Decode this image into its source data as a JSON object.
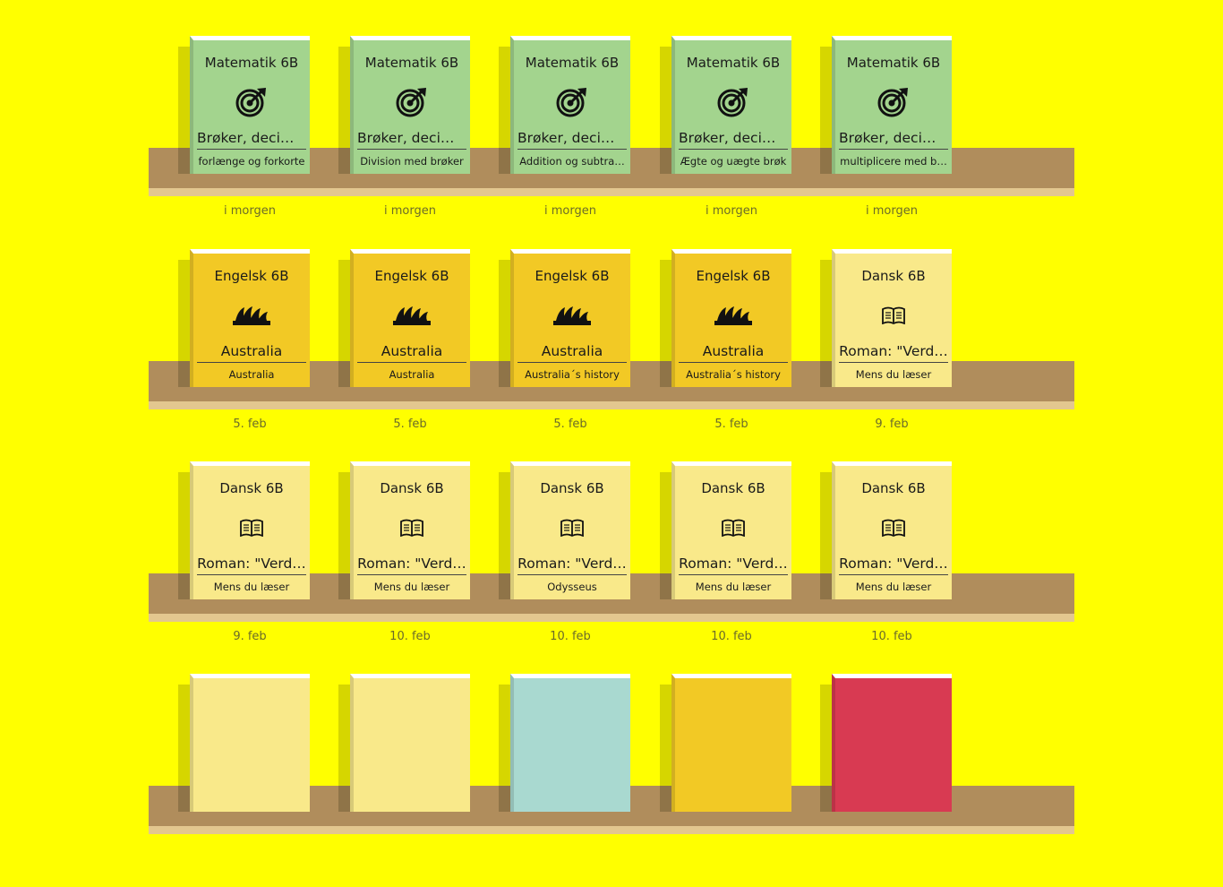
{
  "colors": {
    "background": "#ffff00",
    "matematik": "#a3d48e",
    "engelsk": "#f2c925",
    "dansk": "#f9e98a",
    "teal": "#a9d9d0",
    "red": "#d83a52"
  },
  "rows": [
    {
      "books": [
        {
          "subject": "Matematik 6B",
          "icon": "math-target-icon",
          "topic": "Brøker, decim…",
          "lesson": "forlænge og forkorte",
          "date": "i morgen",
          "theme": "matematik"
        },
        {
          "subject": "Matematik 6B",
          "icon": "math-target-icon",
          "topic": "Brøker, decim…",
          "lesson": "Division med brøker",
          "date": "i morgen",
          "theme": "matematik"
        },
        {
          "subject": "Matematik 6B",
          "icon": "math-target-icon",
          "topic": "Brøker, decim…",
          "lesson": "Addition og subtra…",
          "date": "i morgen",
          "theme": "matematik"
        },
        {
          "subject": "Matematik 6B",
          "icon": "math-target-icon",
          "topic": "Brøker, decim…",
          "lesson": "Ægte og uægte brøk",
          "date": "i morgen",
          "theme": "matematik"
        },
        {
          "subject": "Matematik 6B",
          "icon": "math-target-icon",
          "topic": "Brøker, decim…",
          "lesson": "multiplicere med b…",
          "date": "i morgen",
          "theme": "matematik"
        }
      ]
    },
    {
      "books": [
        {
          "subject": "Engelsk 6B",
          "icon": "opera-house-icon",
          "topic": "Australia",
          "lesson": "Australia",
          "date": "5. feb",
          "theme": "engelsk"
        },
        {
          "subject": "Engelsk 6B",
          "icon": "opera-house-icon",
          "topic": "Australia",
          "lesson": "Australia",
          "date": "5. feb",
          "theme": "engelsk"
        },
        {
          "subject": "Engelsk 6B",
          "icon": "opera-house-icon",
          "topic": "Australia",
          "lesson": "Australia´s history",
          "date": "5. feb",
          "theme": "engelsk"
        },
        {
          "subject": "Engelsk 6B",
          "icon": "opera-house-icon",
          "topic": "Australia",
          "lesson": "Australia´s history",
          "date": "5. feb",
          "theme": "engelsk"
        },
        {
          "subject": "Dansk 6B",
          "icon": "open-book-icon",
          "topic": "Roman: \"Verd…",
          "lesson": "Mens du læser",
          "date": "9. feb",
          "theme": "dansk"
        }
      ]
    },
    {
      "books": [
        {
          "subject": "Dansk 6B",
          "icon": "open-book-icon",
          "topic": "Roman: \"Verd…",
          "lesson": "Mens du læser",
          "date": "9. feb",
          "theme": "dansk"
        },
        {
          "subject": "Dansk 6B",
          "icon": "open-book-icon",
          "topic": "Roman: \"Verd…",
          "lesson": "Mens du læser",
          "date": "10. feb",
          "theme": "dansk"
        },
        {
          "subject": "Dansk 6B",
          "icon": "open-book-icon",
          "topic": "Roman: \"Verd…",
          "lesson": "Odysseus",
          "date": "10. feb",
          "theme": "dansk"
        },
        {
          "subject": "Dansk 6B",
          "icon": "open-book-icon",
          "topic": "Roman: \"Verd…",
          "lesson": "Mens du læser",
          "date": "10. feb",
          "theme": "dansk"
        },
        {
          "subject": "Dansk 6B",
          "icon": "open-book-icon",
          "topic": "Roman: \"Verd…",
          "lesson": "Mens du læser",
          "date": "10. feb",
          "theme": "dansk"
        }
      ]
    },
    {
      "books": [
        {
          "subject": "",
          "icon": "",
          "topic": "",
          "lesson": "",
          "date": "",
          "theme": "dansk"
        },
        {
          "subject": "",
          "icon": "",
          "topic": "",
          "lesson": "",
          "date": "",
          "theme": "dansk"
        },
        {
          "subject": "",
          "icon": "",
          "topic": "",
          "lesson": "",
          "date": "",
          "theme": "teal"
        },
        {
          "subject": "",
          "icon": "",
          "topic": "",
          "lesson": "",
          "date": "",
          "theme": "engelsk"
        },
        {
          "subject": "",
          "icon": "",
          "topic": "",
          "lesson": "",
          "date": "",
          "theme": "red"
        }
      ]
    }
  ]
}
